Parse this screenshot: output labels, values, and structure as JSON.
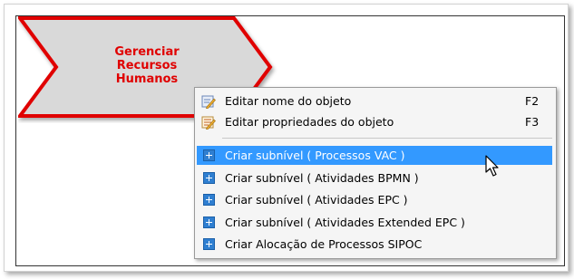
{
  "shape": {
    "label_lines": [
      "Gerenciar",
      "Recursos",
      "Humanos"
    ],
    "fill_color": "#d9d9d9",
    "border_color": "#e00000",
    "text_color": "#e00000"
  },
  "context_menu": {
    "items": [
      {
        "label": "Editar nome do objeto",
        "shortcut": "F2",
        "icon": "edit-name-icon"
      },
      {
        "label": "Editar propriedades do objeto",
        "shortcut": "F3",
        "icon": "edit-properties-icon"
      },
      {
        "label": "Criar subnível  ( Processos VAC )",
        "shortcut": "",
        "icon": "add-subnivel-icon",
        "highlighted": true
      },
      {
        "label": "Criar subnível  ( Atividades BPMN )",
        "shortcut": "",
        "icon": "add-subnivel-icon"
      },
      {
        "label": "Criar subnível  ( Atividades EPC )",
        "shortcut": "",
        "icon": "add-subnivel-icon"
      },
      {
        "label": "Criar subnível  ( Atividades Extended EPC )",
        "shortcut": "",
        "icon": "add-subnivel-icon"
      },
      {
        "label": "Criar Alocação de Processos SIPOC",
        "shortcut": "",
        "icon": "add-subnivel-icon"
      }
    ],
    "highlight_color": "#3399ff"
  }
}
